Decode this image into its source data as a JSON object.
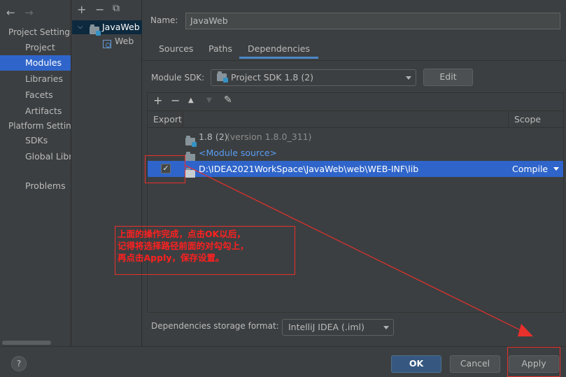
{
  "sidebar": {
    "back_icon": "←",
    "forward_icon": "→",
    "project_settings_header": "Project Settings",
    "project_settings_items": [
      "Project",
      "Modules",
      "Libraries",
      "Facets",
      "Artifacts"
    ],
    "platform_settings_header": "Platform Settings",
    "platform_settings_items": [
      "SDKs",
      "Global Libraries"
    ],
    "problems_label": "Problems",
    "selected_item": "Modules"
  },
  "module_tree": {
    "toolbar": {
      "add_icon": "+",
      "remove_icon": "−",
      "copy_icon": "⧉"
    },
    "root": {
      "label": "JavaWeb",
      "expanded": true
    },
    "child": {
      "label": "Web"
    }
  },
  "form": {
    "name_label": "Name:",
    "name_value": "JavaWeb"
  },
  "tabs": {
    "items": [
      "Sources",
      "Paths",
      "Dependencies"
    ],
    "active": "Dependencies"
  },
  "module_sdk": {
    "label": "Module SDK:",
    "value": "Project SDK 1.8 (2)",
    "edit_button": "Edit"
  },
  "deps_toolbar": {
    "add_icon": "+",
    "remove_icon": "−",
    "up_icon": "▲",
    "down_icon": "▼",
    "edit_icon": "✎"
  },
  "deps_table": {
    "columns": {
      "export": "Export",
      "scope": "Scope"
    },
    "rows": [
      {
        "name": "1.8 (2)",
        "note": "(version 1.8.0_311)",
        "scope": "",
        "checked": false,
        "selected": false
      },
      {
        "name": "<Module source>",
        "scope": "",
        "checked": false,
        "selected": false
      },
      {
        "name": "D:\\IDEA2021WorkSpace\\JavaWeb\\web\\WEB-INF\\lib",
        "scope": "Compile",
        "checked": true,
        "selected": true
      }
    ],
    "check_glyph": "✓"
  },
  "annotation": {
    "lines": [
      "上面的操作完成，点击OK以后，",
      "记得将选择路径前面的对勾勾上，",
      "再点击Apply，保存设置。"
    ],
    "color": "#e8302c"
  },
  "storage_format": {
    "label": "Dependencies storage format:",
    "value": "IntelliJ IDEA (.iml)"
  },
  "footer": {
    "help_label": "?",
    "ok_label": "OK",
    "cancel_label": "Cancel",
    "apply_label": "Apply"
  }
}
